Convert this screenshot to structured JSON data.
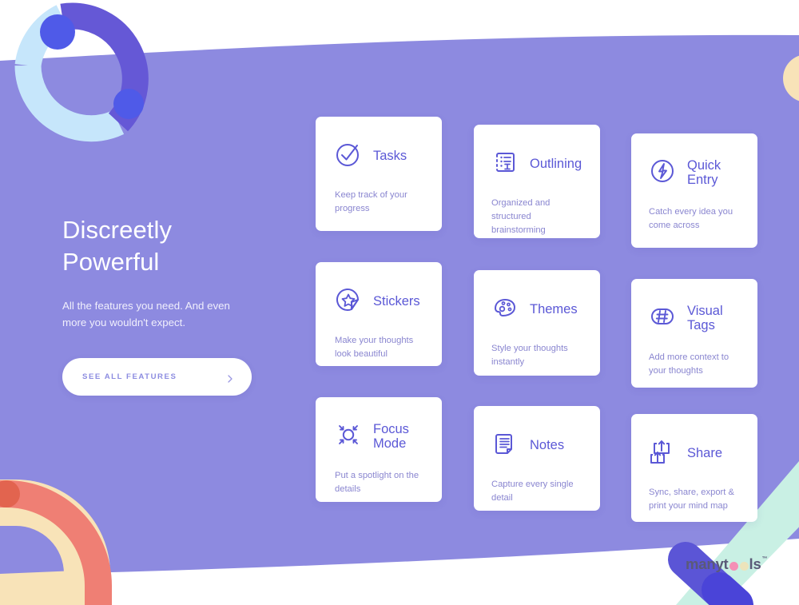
{
  "theme": {
    "background_purple": "#8d8ae0",
    "page_white": "#ffffff",
    "card_white": "#ffffff",
    "card_title_color": "#5b58d6",
    "card_desc_color": "#8a86d0",
    "button_text_color": "#8c8ce0",
    "ring_dark_purple": "#6558d6",
    "ring_light_blue": "#c6e6fb",
    "ring_dot_blue": "#4f5ae8",
    "coral": "#ef7f74",
    "cream": "#f8e3b8",
    "mint": "#c9f0e4",
    "logo_text_color": "#5a5a78",
    "logo_dot_pink": "#f48fb6",
    "logo_dot_cream": "#ece4bb"
  },
  "hero": {
    "title_line1": "Discreetly",
    "title_line2": "Powerful",
    "subtitle": "All the features you need. And even more you wouldn't expect.",
    "cta_label": "SEE ALL FEATURES",
    "cta_icon": "chevron-right-icon"
  },
  "features": [
    {
      "id": "tasks",
      "title": "Tasks",
      "title_line1": "Tasks",
      "title_line2": "",
      "description": "Keep track of your progress",
      "icon": "check-circle-icon",
      "column": "A",
      "row": 1
    },
    {
      "id": "outlining",
      "title": "Outlining",
      "title_line1": "Outlining",
      "title_line2": "",
      "description": "Organized and structured brainstorming",
      "icon": "document-outline-icon",
      "column": "B",
      "row": 1
    },
    {
      "id": "quick-entry",
      "title": "Quick Entry",
      "title_line1": "Quick",
      "title_line2": "Entry",
      "description": "Catch every idea you come across",
      "icon": "lightning-circle-icon",
      "column": "C",
      "row": 1
    },
    {
      "id": "stickers",
      "title": "Stickers",
      "title_line1": "Stickers",
      "title_line2": "",
      "description": "Make your thoughts look beautiful",
      "icon": "star-sticker-icon",
      "column": "A",
      "row": 2
    },
    {
      "id": "themes",
      "title": "Themes",
      "title_line1": "Themes",
      "title_line2": "",
      "description": "Style your thoughts instantly",
      "icon": "palette-icon",
      "column": "B",
      "row": 2
    },
    {
      "id": "visual-tags",
      "title": "Visual Tags",
      "title_line1": "Visual",
      "title_line2": "Tags",
      "description": "Add more context to your thoughts",
      "icon": "hashtag-pill-icon",
      "column": "C",
      "row": 2
    },
    {
      "id": "focus-mode",
      "title": "Focus Mode",
      "title_line1": "Focus",
      "title_line2": "Mode",
      "description": "Put a spotlight on the details",
      "icon": "focus-arrows-icon",
      "column": "A",
      "row": 3
    },
    {
      "id": "notes",
      "title": "Notes",
      "title_line1": "Notes",
      "title_line2": "",
      "description": "Capture every single detail",
      "icon": "note-document-icon",
      "column": "B",
      "row": 3
    },
    {
      "id": "share",
      "title": "Share",
      "title_line1": "Share",
      "title_line2": "",
      "description": "Sync, share, export & print your mind map",
      "icon": "share-upload-icon",
      "column": "C",
      "row": 3
    }
  ],
  "logo": {
    "part1": "many",
    "part2": "t",
    "part3": "ls",
    "trademark": "™"
  }
}
